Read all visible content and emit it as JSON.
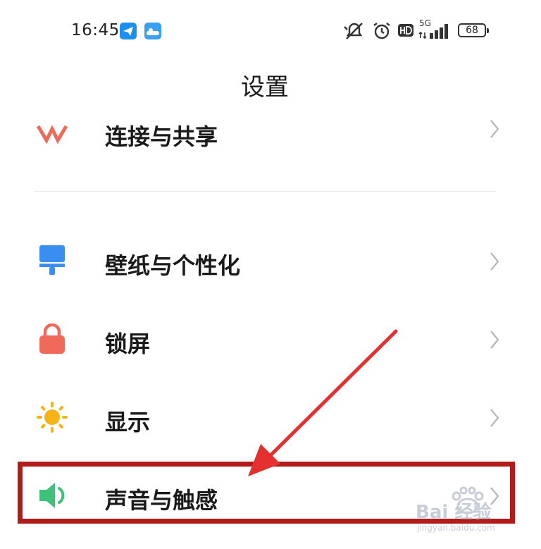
{
  "status_bar": {
    "time": "16:45",
    "network": "5G",
    "battery": "68"
  },
  "header": {
    "title": "设置"
  },
  "rows": [
    {
      "label": "连接与共享"
    },
    {
      "label": "壁纸与个性化"
    },
    {
      "label": "锁屏"
    },
    {
      "label": "显示"
    },
    {
      "label": "声音与触感"
    }
  ],
  "watermark": {
    "brand": "Bai 经验",
    "url": "jingyan.baidu.com"
  },
  "colors": {
    "highlight_border": "#b31b1b",
    "arrow": "#e53030",
    "wallpaper_icon": "#3a8ef0",
    "lock_icon": "#f06a5c",
    "display_icon": "#f5b316",
    "sound_icon": "#3ec27a"
  }
}
